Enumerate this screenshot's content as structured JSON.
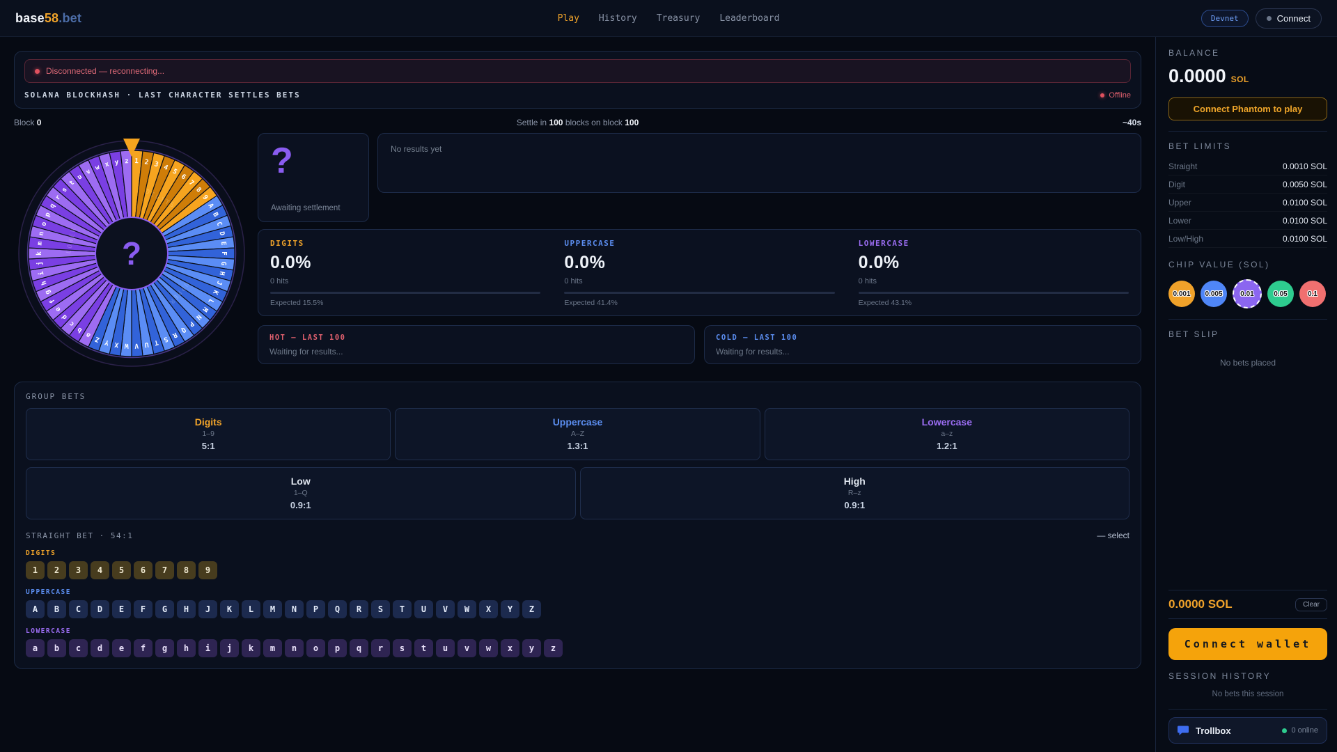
{
  "nav": {
    "logo_base": "base",
    "logo_num": "58",
    "logo_tld": ".bet",
    "links": [
      {
        "label": "Play",
        "active": true
      },
      {
        "label": "History",
        "active": false
      },
      {
        "label": "Treasury",
        "active": false
      },
      {
        "label": "Leaderboard",
        "active": false
      }
    ],
    "network_badge": "Devnet",
    "connect_label": "Connect"
  },
  "status": {
    "banner_text": "Disconnected — reconnecting...",
    "subtitle": "SOLANA BLOCKHASH · LAST CHARACTER SETTLES BETS",
    "connection_label": "Offline"
  },
  "block_row": {
    "left_label": "Block",
    "left_value": "0",
    "center_parts": [
      "Settle in",
      "100",
      "blocks on block",
      "100"
    ],
    "eta": "~40s"
  },
  "wheel": {
    "center_symbol": "?",
    "pointer_color": "#f5a31f",
    "groups": [
      {
        "name": "DIGITS",
        "colors": [
          "#f6a41f",
          "#cf7d08"
        ],
        "chars": [
          "1",
          "2",
          "3",
          "4",
          "5",
          "6",
          "7",
          "8",
          "9"
        ]
      },
      {
        "name": "UPPER",
        "colors": [
          "#5b8df5",
          "#3263d9"
        ],
        "chars": [
          "A",
          "B",
          "C",
          "D",
          "E",
          "F",
          "G",
          "H",
          "J",
          "K",
          "L",
          "M",
          "N",
          "P",
          "Q",
          "R",
          "S",
          "T",
          "U",
          "V",
          "W",
          "X",
          "Y",
          "Z"
        ]
      },
      {
        "name": "LOWER",
        "colors": [
          "#9d6cf2",
          "#7a3fe3"
        ],
        "chars": [
          "a",
          "b",
          "c",
          "d",
          "e",
          "f",
          "g",
          "h",
          "i",
          "j",
          "k",
          "m",
          "n",
          "o",
          "p",
          "q",
          "r",
          "s",
          "t",
          "u",
          "v",
          "w",
          "x",
          "y",
          "z"
        ]
      }
    ]
  },
  "awaiting": {
    "symbol": "?",
    "label": "Awaiting settlement"
  },
  "results_panel": {
    "empty_text": "No results yet"
  },
  "stats": [
    {
      "label": "DIGITS",
      "color": "#f0a32a",
      "value": "0.0%",
      "hits": "0 hits",
      "expected": "Expected 15.5%"
    },
    {
      "label": "UPPERCASE",
      "color": "#5b8def",
      "value": "0.0%",
      "hits": "0 hits",
      "expected": "Expected 41.4%"
    },
    {
      "label": "LOWERCASE",
      "color": "#9b6df2",
      "value": "0.0%",
      "hits": "0 hits",
      "expected": "Expected 43.1%"
    }
  ],
  "hot_cold": [
    {
      "title": "HOT — LAST 100",
      "color": "#e0606e",
      "body": "Waiting for results..."
    },
    {
      "title": "COLD — LAST 100",
      "color": "#5b8def",
      "body": "Waiting for results..."
    }
  ],
  "group_bets": {
    "title": "GROUP BETS",
    "cards": [
      {
        "name": "Digits",
        "range": "1–9",
        "odds": "5:1",
        "color": "#f0a32a"
      },
      {
        "name": "Uppercase",
        "range": "A–Z",
        "odds": "1.3:1",
        "color": "#5b8def"
      },
      {
        "name": "Lowercase",
        "range": "a–z",
        "odds": "1.2:1",
        "color": "#9b6df2"
      }
    ],
    "wide_cards": [
      {
        "name": "Low",
        "range": "1–Q",
        "odds": "0.9:1"
      },
      {
        "name": "High",
        "range": "R–z",
        "odds": "0.9:1"
      }
    ],
    "straight_label": "STRAIGHT BET · 54:1",
    "select_hint": "— select",
    "char_sections": [
      {
        "label": "DIGITS",
        "color": "#f0a32a",
        "style": "digit",
        "wheel_group": 0
      },
      {
        "label": "UPPERCASE",
        "color": "#5b8def",
        "style": "upper",
        "wheel_group": 1
      },
      {
        "label": "LOWERCASE",
        "color": "#9b6df2",
        "style": "lower",
        "wheel_group": 2
      }
    ]
  },
  "sidebar": {
    "balance": {
      "title": "BALANCE",
      "value": "0.0000",
      "unit": "SOL",
      "cta": "Connect Phantom to play"
    },
    "bet_limits": {
      "title": "BET LIMITS",
      "rows": [
        {
          "label": "Straight",
          "value": "0.0010 SOL"
        },
        {
          "label": "Digit",
          "value": "0.0050 SOL"
        },
        {
          "label": "Upper",
          "value": "0.0100 SOL"
        },
        {
          "label": "Lower",
          "value": "0.0100 SOL"
        },
        {
          "label": "Low/High",
          "value": "0.0100 SOL"
        }
      ]
    },
    "chip_value": {
      "title": "CHIP VALUE (SOL)",
      "chips": [
        {
          "label": "0.001",
          "color": "#f0a22a",
          "selected": false
        },
        {
          "label": "0.005",
          "color": "#4f86f7",
          "selected": false
        },
        {
          "label": "0.01",
          "color": "#8b66f0",
          "selected": true
        },
        {
          "label": "0.05",
          "color": "#2ecc8f",
          "selected": false
        },
        {
          "label": "0.1",
          "color": "#f07070",
          "selected": false
        }
      ]
    },
    "bet_slip": {
      "title": "BET SLIP",
      "empty": "No bets placed",
      "total": "0.0000 SOL",
      "clear": "Clear"
    },
    "connect_wallet": "Connect wallet",
    "session": {
      "title": "SESSION HISTORY",
      "empty": "No bets this session"
    },
    "trollbox": {
      "label": "Trollbox",
      "online": "0 online"
    }
  }
}
